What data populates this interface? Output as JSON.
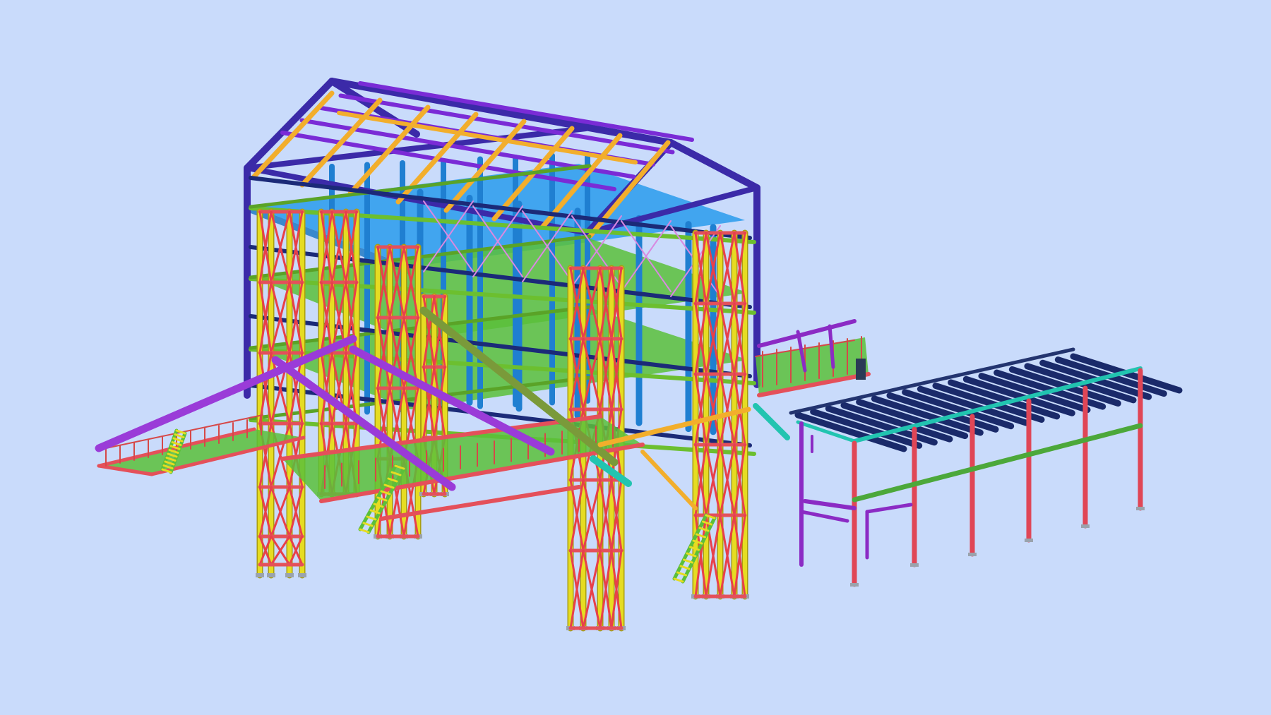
{
  "scene": {
    "background": "#c9dbfb"
  },
  "palette": {
    "column": "#e6dc22",
    "column_edge": "#a99e10",
    "brace": "#e8404a",
    "deck_beam": "#e4505a",
    "grating": "#5bbf3a",
    "frame": "#3b2aa8",
    "rafter": "#f2ae2c",
    "purlin": "#7a2bd6",
    "post_blue": "#1f7fd1",
    "roof_panel": "#3aa2ee",
    "canopy_purlin": "#1a2a6a",
    "canopy_eave": "#22c4b0",
    "canopy_post": "#e04656",
    "canopy_rail": "#4ca83a",
    "canopy_frame": "#8b2bc4",
    "stair_stringer": "#7a2bd6",
    "handrail": "#d64848",
    "chute": "#9a3bd8",
    "conveyor": "#7a9a3a",
    "chute_tip": "#22c4b0",
    "base_plate": "#9aa3ad",
    "pipe": "#8b2bc4",
    "pipe_cap": "#2a3a55"
  }
}
